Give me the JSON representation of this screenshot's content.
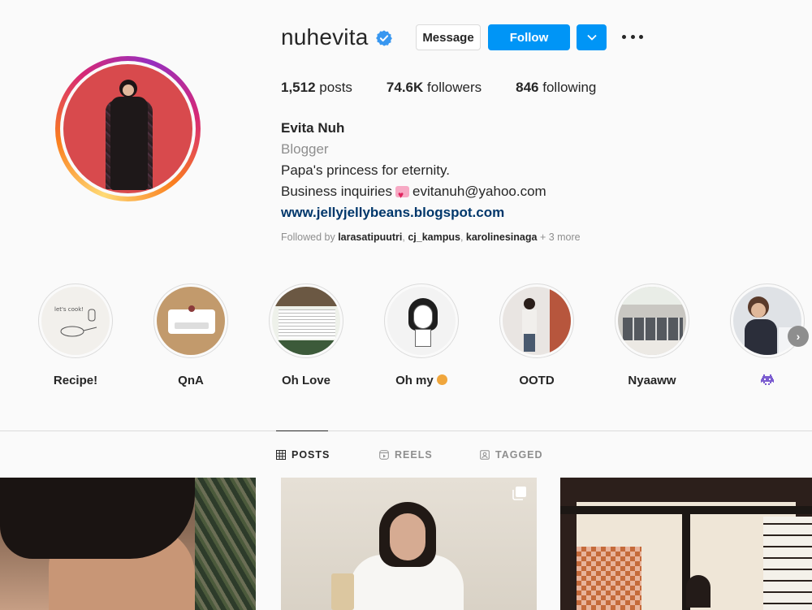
{
  "profile": {
    "username": "nuhevita",
    "verified": true,
    "message_label": "Message",
    "follow_label": "Follow",
    "stats": {
      "posts_count": "1,512",
      "posts_label": "posts",
      "followers_count": "74.6K",
      "followers_label": "followers",
      "following_count": "846",
      "following_label": "following"
    },
    "bio": {
      "name": "Evita Nuh",
      "category": "Blogger",
      "line1": "Papa's princess for eternity.",
      "line2_prefix": "Business inquiries",
      "line2_email": "evitanuh@yahoo.com",
      "website": "www.jellyjellybeans.blogspot.com"
    },
    "followed_by": {
      "prefix": "Followed by",
      "users": [
        "larasatipuutri",
        "cj_kampus",
        "karolinesinaga"
      ],
      "more": "+ 3 more"
    }
  },
  "highlights": [
    {
      "label": "Recipe!"
    },
    {
      "label": "QnA"
    },
    {
      "label": "Oh Love"
    },
    {
      "label": "Oh my",
      "emoji": "💭"
    },
    {
      "label": "OOTD"
    },
    {
      "label": "Nyaaww"
    },
    {
      "label": "",
      "emoji": "👾"
    }
  ],
  "tabs": [
    {
      "label": "POSTS",
      "active": true
    },
    {
      "label": "REELS",
      "active": false
    },
    {
      "label": "TAGGED",
      "active": false
    }
  ],
  "colors": {
    "accent": "#0095f6",
    "link": "#00376b",
    "muted": "#8e8e8e",
    "text": "#262626"
  }
}
